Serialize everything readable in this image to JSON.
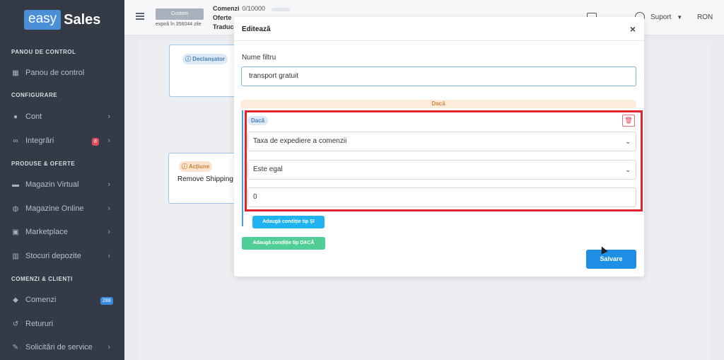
{
  "sidebar": {
    "logo_easy": "easy",
    "logo_sales": "Sales",
    "sections": {
      "panou": "PANOU DE CONTROL",
      "configurare": "CONFIGURARE",
      "produse": "PRODUSE & OFERTE",
      "comenzi": "COMENZI & CLIENȚI"
    },
    "items": [
      {
        "label": "Panou de control",
        "icon": "dashboard-icon"
      },
      {
        "label": "Cont",
        "icon": "user-icon"
      },
      {
        "label": "Integrări",
        "icon": "link-icon",
        "badge": "8"
      },
      {
        "label": "Magazin Virtual",
        "icon": "store-icon"
      },
      {
        "label": "Magazine Online",
        "icon": "globe-icon"
      },
      {
        "label": "Marketplace",
        "icon": "marketplace-icon"
      },
      {
        "label": "Stocuri depozite",
        "icon": "warehouse-icon"
      },
      {
        "label": "Comenzi",
        "icon": "tag-icon",
        "badge": "288"
      },
      {
        "label": "Retururi",
        "icon": "return-icon"
      },
      {
        "label": "Solicitări de service",
        "icon": "wrench-icon"
      }
    ]
  },
  "topbar": {
    "plan": "Custom",
    "expires": "expiră în 356044 zile",
    "comenzi_label": "Comenzi",
    "comenzi_value": "0/10000",
    "oferte_label": "Oferte",
    "traduceri_label": "Traduc",
    "support": "Suport",
    "currency": "RON"
  },
  "workflow": {
    "trigger_tag": "Declanșator",
    "action_tag": "Acțiune",
    "action_text": "Remove Shipping"
  },
  "modal": {
    "title": "Editează",
    "filter_label": "Nume filtru",
    "filter_value": "transport gratuit",
    "daca_header": "Dacă",
    "daca_tag": "Dacă",
    "field_select": "Taxa de expediere a comenzii",
    "operator_select": "Este egal",
    "value_input": "0",
    "add_and_button": "Adaugă condiție tip ȘI",
    "add_if_button": "Adaugă condiție tip DACĂ",
    "save_button": "Salvare"
  },
  "colors": {
    "sidebar": "#343a46",
    "accent": "#1f8fe6",
    "highlight": "#e0232c",
    "green_btn": "#4fcf95",
    "cyan_btn": "#1fb4f0"
  }
}
